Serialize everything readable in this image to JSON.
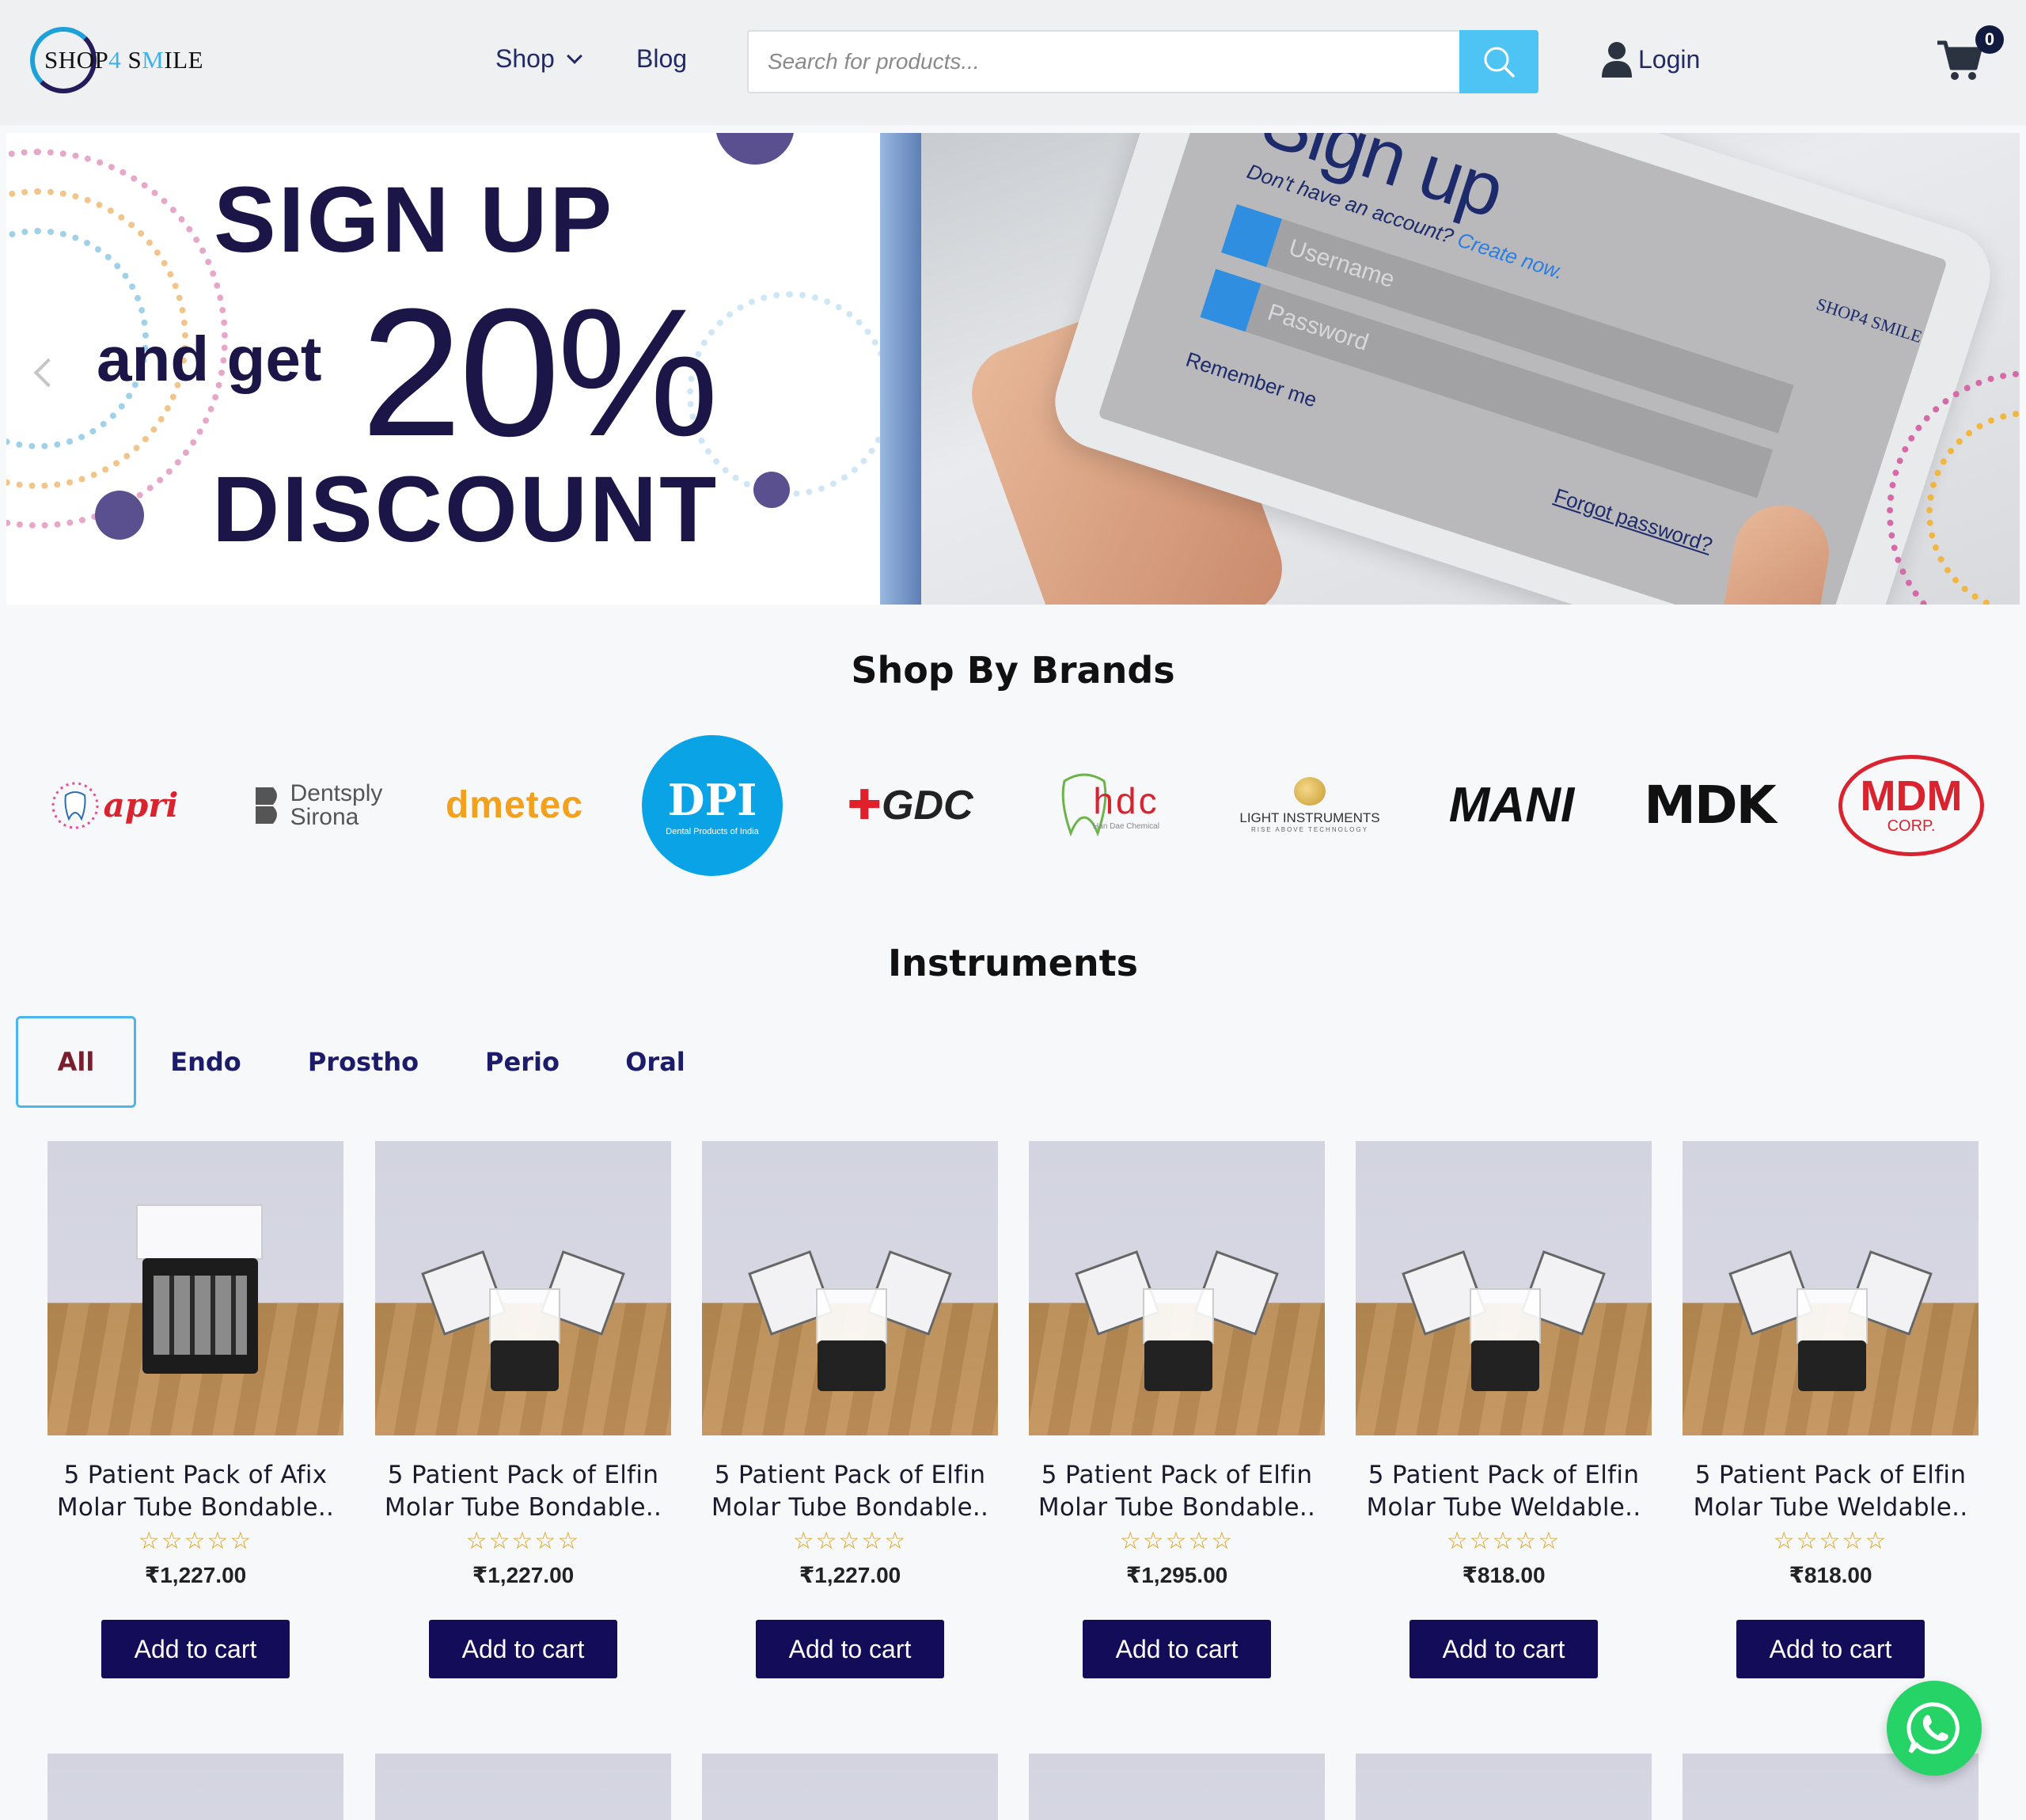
{
  "header": {
    "logo_text_a": "SHOP",
    "logo_text_b": "4",
    "logo_text_c": " S",
    "logo_text_d": "M",
    "logo_text_e": "ILE",
    "nav_shop": "Shop",
    "nav_blog": "Blog",
    "search_placeholder": "Search for products...",
    "login": "Login",
    "cart_count": "0"
  },
  "banner": {
    "line1": "SIGN UP",
    "line2": "and get",
    "line3": "20%",
    "line4": "DISCOUNT",
    "tablet_title": "Sign up",
    "tablet_sub": "Don't have an account?",
    "tablet_sub_link": "Create now.",
    "tablet_username": "Username",
    "tablet_password": "Password",
    "tablet_remember": "Remember me",
    "tablet_forgot": "Forgot password?",
    "tablet_logo": "SHOP4 SMILE"
  },
  "brands": {
    "title": "Shop By Brands",
    "items": [
      "apri",
      "Dentsply Sirona",
      "dmetec",
      "DPI",
      "GDC",
      "hdc",
      "LIGHT INSTRUMENTS",
      "MANI",
      "MDK",
      "MDM"
    ],
    "dpi_sub": "Dental Products of India",
    "light_sub": "RISE ABOVE TECHNOLOGY",
    "hdc_sub": "Han Dae Chemical",
    "mdm_sub": "CORP.",
    "dentsply_a": "Dentsply",
    "dentsply_b": "Sirona"
  },
  "instruments": {
    "title": "Instruments",
    "tabs": [
      "All",
      "Endo",
      "Prostho",
      "Perio",
      "Oral"
    ]
  },
  "products": [
    {
      "line1": "5 Patient Pack of Afix",
      "line2": "Molar Tube Bondable..",
      "rating": "☆☆☆☆☆",
      "price": "₹1,227.00",
      "cta": "Add to cart"
    },
    {
      "line1": "5 Patient Pack of Elfin",
      "line2": "Molar Tube Bondable..",
      "rating": "☆☆☆☆☆",
      "price": "₹1,227.00",
      "cta": "Add to cart"
    },
    {
      "line1": "5 Patient Pack of Elfin",
      "line2": "Molar Tube Bondable..",
      "rating": "☆☆☆☆☆",
      "price": "₹1,227.00",
      "cta": "Add to cart"
    },
    {
      "line1": "5 Patient Pack of Elfin",
      "line2": "Molar Tube Bondable..",
      "rating": "☆☆☆☆☆",
      "price": "₹1,295.00",
      "cta": "Add to cart"
    },
    {
      "line1": "5 Patient Pack of Elfin",
      "line2": "Molar Tube Weldable..",
      "rating": "☆☆☆☆☆",
      "price": "₹818.00",
      "cta": "Add to cart"
    },
    {
      "line1": "5 Patient Pack of Elfin",
      "line2": "Molar Tube Weldable..",
      "rating": "☆☆☆☆☆",
      "price": "₹818.00",
      "cta": "Add to cart"
    }
  ],
  "colors": {
    "accent": "#4dc4f3",
    "navy": "#130c58",
    "whatsapp": "#25d366"
  }
}
